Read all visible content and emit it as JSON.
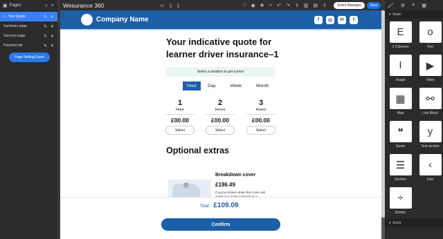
{
  "app": {
    "brand": "Wesurance 360",
    "event_manager_label": "Event Manager",
    "save_label": "Save",
    "device_icons": [
      "desktop-icon",
      "tablet-icon",
      "mobile-icon"
    ],
    "tool_icons": [
      "square-icon",
      "eye-icon",
      "move-icon",
      "code-icon",
      "undo-icon",
      "redo-icon",
      "upload-icon",
      "trash-icon",
      "folder-icon",
      "download-icon"
    ]
  },
  "pages_panel": {
    "title": "Pages",
    "add_label": "+",
    "close_label": "×",
    "pages": [
      {
        "name": "Your Quote",
        "active": true
      },
      {
        "name": "Summary page",
        "active": false
      },
      {
        "name": "Success page",
        "active": false
      },
      {
        "name": "Payment fail",
        "active": false
      }
    ],
    "page_setting_label": "Page Setting Event"
  },
  "blocks_panel": {
    "basic_label": "Basic",
    "extra_label": "Extra",
    "blocks": [
      {
        "label": "3 Columns",
        "glyph": "E"
      },
      {
        "label": "Text",
        "glyph": "o"
      },
      {
        "label": "Image",
        "glyph": "I"
      },
      {
        "label": "Video",
        "glyph": "▶"
      },
      {
        "label": "Map",
        "glyph": "▦"
      },
      {
        "label": "Link Block",
        "glyph": "⚯"
      },
      {
        "label": "Quote",
        "glyph": "❝"
      },
      {
        "label": "Text section",
        "glyph": "y"
      },
      {
        "label": "Section",
        "glyph": "☰"
      },
      {
        "label": "Icon",
        "glyph": "‹"
      },
      {
        "label": "Divider",
        "glyph": "÷"
      }
    ]
  },
  "site": {
    "company_name": "Company Name",
    "socials": [
      "f",
      "◎",
      "in",
      "t"
    ],
    "headline": "Your indicative quote for learner driver insurance–1",
    "duration_prompt": "Select a duration to get a price",
    "tabs": [
      "Hour",
      "Day",
      "Week",
      "Month"
    ],
    "active_tab": "Hour",
    "options": [
      {
        "count": "1",
        "unit": "Hour",
        "price": "£00.00",
        "select": "Select"
      },
      {
        "count": "2",
        "unit": "Hours",
        "price": "£00.00",
        "select": "Select"
      },
      {
        "count": "3",
        "unit": "Hours",
        "price": "£00.00",
        "select": "Select"
      }
    ],
    "extras_title": "Optional extras",
    "extra": {
      "title": "Breakdown cover",
      "price": "£196.49",
      "description": "If you've broken down this cover will assist you at the roadside as a minimum..."
    },
    "total_label": "Total:",
    "total_value": "£109.09",
    "confirm_label": "Confirm"
  }
}
